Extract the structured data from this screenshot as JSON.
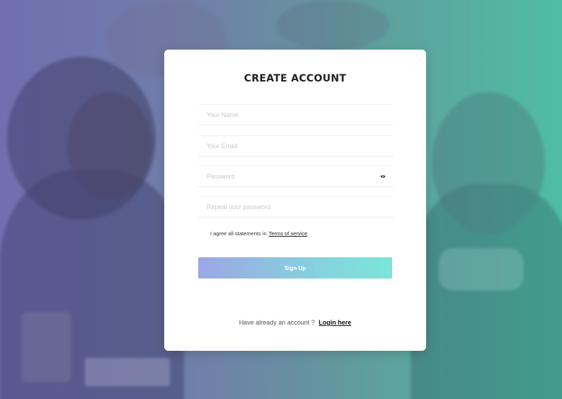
{
  "form": {
    "title": "CREATE ACCOUNT",
    "name_placeholder": "Your Name",
    "email_placeholder": "Your Email",
    "password_placeholder": "Password",
    "repeat_placeholder": "Repeat your password",
    "password_toggle_icon": "eye-icon",
    "agree_text": "I agree all statements in",
    "terms_link": "Terms of service",
    "signup_label": "Sign Up",
    "login_prompt": "Have already an account ?",
    "login_link": "Login here"
  },
  "colors": {
    "button_gradient_start": "#9ca7e4",
    "button_gradient_end": "#7ae6d8",
    "card_background": "#ffffff"
  }
}
